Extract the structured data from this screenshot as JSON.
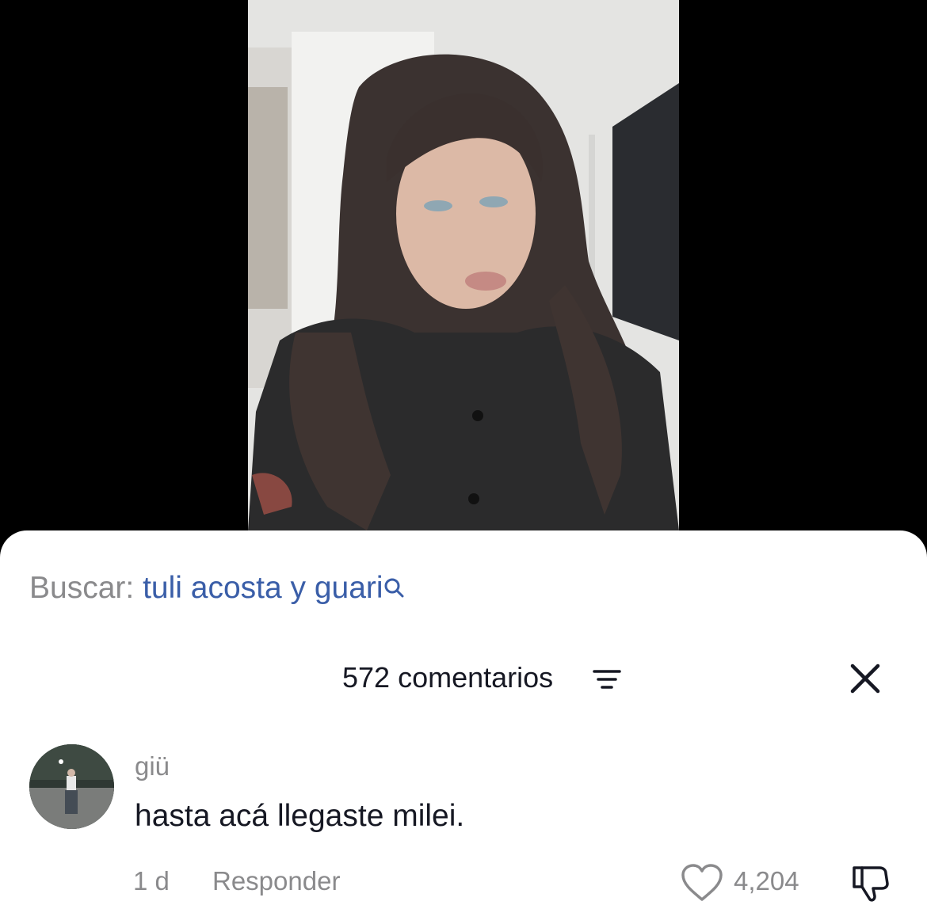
{
  "search": {
    "prefix": "Buscar:",
    "query": "tuli acosta y guari"
  },
  "comments_header": {
    "count_label": "572 comentarios"
  },
  "comment": {
    "username": "giü",
    "text": "hasta acá llegaste milei.",
    "time": "1 d",
    "reply_label": "Responder",
    "likes": "4,204"
  },
  "icons": {
    "search": "search-icon",
    "sort": "sort-icon",
    "close": "close-icon",
    "like": "heart-icon",
    "dislike": "thumbs-down-icon"
  },
  "colors": {
    "search_query": "#3a5ea8",
    "secondary_text": "#8a8a8c",
    "primary_text": "#161823"
  }
}
